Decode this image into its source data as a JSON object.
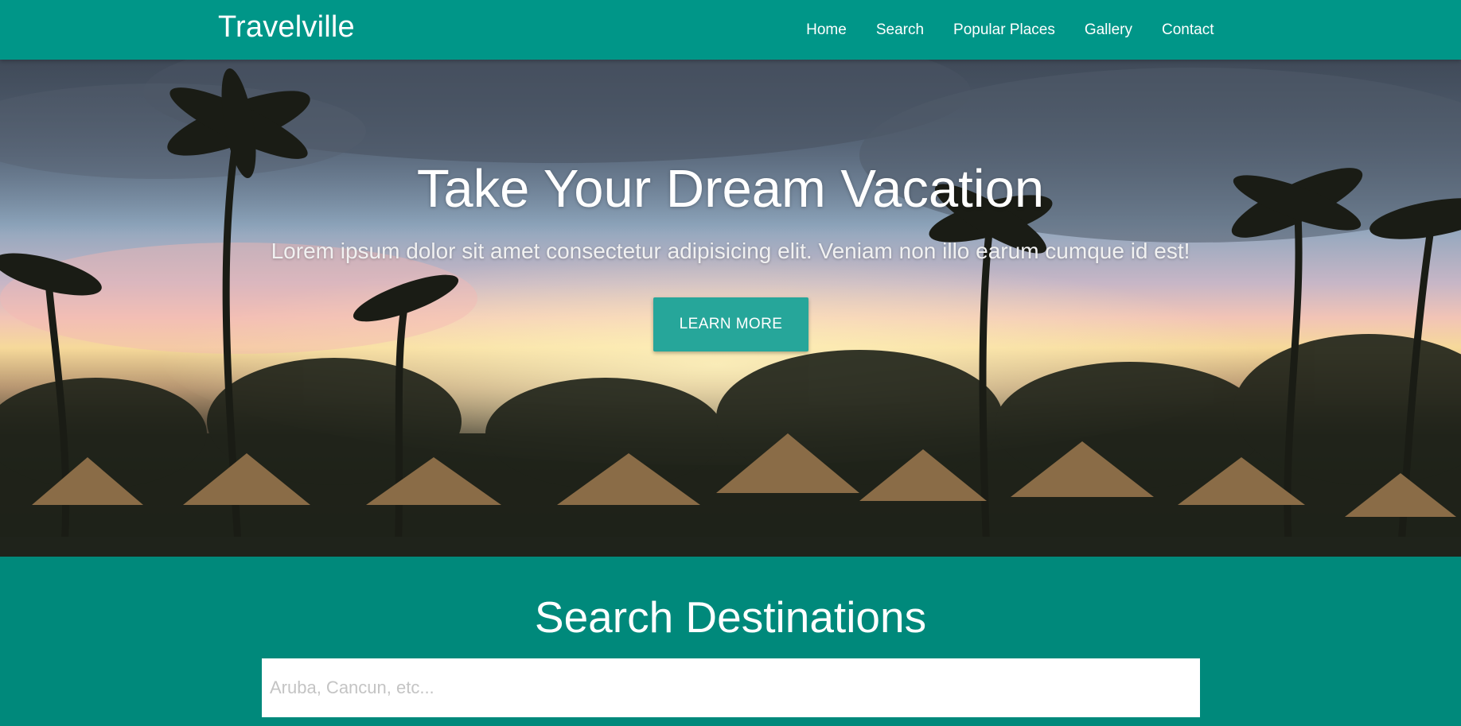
{
  "navbar": {
    "brand": "Travelville",
    "links": [
      "Home",
      "Search",
      "Popular Places",
      "Gallery",
      "Contact"
    ]
  },
  "hero": {
    "title": "Take Your Dream Vacation",
    "subtitle": "Lorem ipsum dolor sit amet consectetur adipisicing elit. Veniam non illo earum cumque id est!",
    "button_label": "LEARN MORE"
  },
  "search": {
    "title": "Search Destinations",
    "placeholder": "Aruba, Cancun, etc..."
  },
  "colors": {
    "navbar": "#009688",
    "button": "#26a69a",
    "search_section": "#00897b"
  }
}
